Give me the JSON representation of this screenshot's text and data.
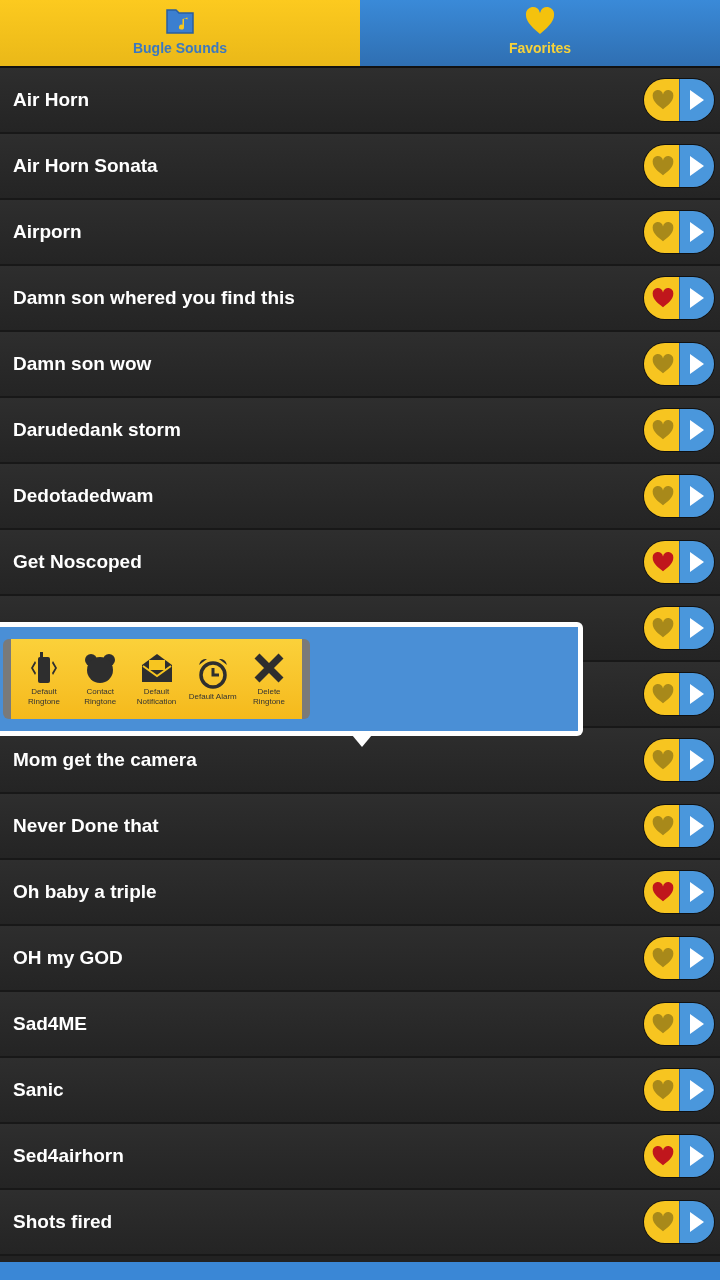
{
  "tabs": [
    {
      "label": "Bugle Sounds",
      "kind": "folder",
      "selected": true
    },
    {
      "label": "Favorites",
      "kind": "heart",
      "selected": false
    }
  ],
  "sounds": [
    {
      "name": "Air Horn",
      "favorite": false
    },
    {
      "name": "Air Horn Sonata",
      "favorite": false
    },
    {
      "name": "Airporn",
      "favorite": false
    },
    {
      "name": "Damn son whered you find this",
      "favorite": true
    },
    {
      "name": "Damn son wow",
      "favorite": false
    },
    {
      "name": "Darudedank storm",
      "favorite": false
    },
    {
      "name": "Dedotadedwam",
      "favorite": false
    },
    {
      "name": "Get Noscoped",
      "favorite": true
    },
    {
      "favorite": false
    },
    {
      "favorite": false
    },
    {
      "name": "Mom get the camera",
      "favorite": false
    },
    {
      "name": "Never Done that",
      "favorite": false
    },
    {
      "name": "Oh baby a triple",
      "favorite": true
    },
    {
      "name": "OH my GOD",
      "favorite": false
    },
    {
      "name": "Sad4ME",
      "favorite": false
    },
    {
      "name": "Sanic",
      "favorite": false
    },
    {
      "name": "Sed4airhorn",
      "favorite": true
    },
    {
      "name": "Shots fired",
      "favorite": false
    }
  ],
  "popup_actions": [
    {
      "kind": "phone",
      "label": "Default Ringtone"
    },
    {
      "kind": "contact",
      "label": "Contact Ringtone"
    },
    {
      "kind": "mail",
      "label": "Default Notification"
    },
    {
      "kind": "alarm",
      "label": "Default Alarm"
    },
    {
      "kind": "delete",
      "label": "Delete Ringtone"
    }
  ]
}
